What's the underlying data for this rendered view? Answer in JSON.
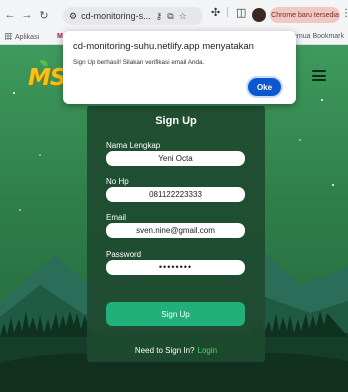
{
  "browser": {
    "url": "cd-monitoring-s...",
    "update_label": "Chrome baru tersedia",
    "bookmark_apps": "Aplikasi",
    "bookmark_m": "M",
    "bookmark_all": "Semua Bookmark"
  },
  "app": {
    "logo": "MS"
  },
  "form": {
    "title": "Sign Up",
    "name_label": "Nama Lengkap",
    "name_value": "Yeni Octa",
    "phone_label": "No Hp",
    "phone_value": "081122223333",
    "email_label": "Email",
    "email_value": "sven.nine@gmail.com",
    "password_label": "Password",
    "password_value": "••••••••",
    "submit_label": "Sign Up",
    "signin_prompt": "Need to Sign In?",
    "login_link": "Login"
  },
  "dialog": {
    "title": "cd-monitoring-suhu.netlify.app menyatakan",
    "message": "Sign Up berhasil! Silakan verifikasi email Anda.",
    "ok_label": "Oke"
  }
}
